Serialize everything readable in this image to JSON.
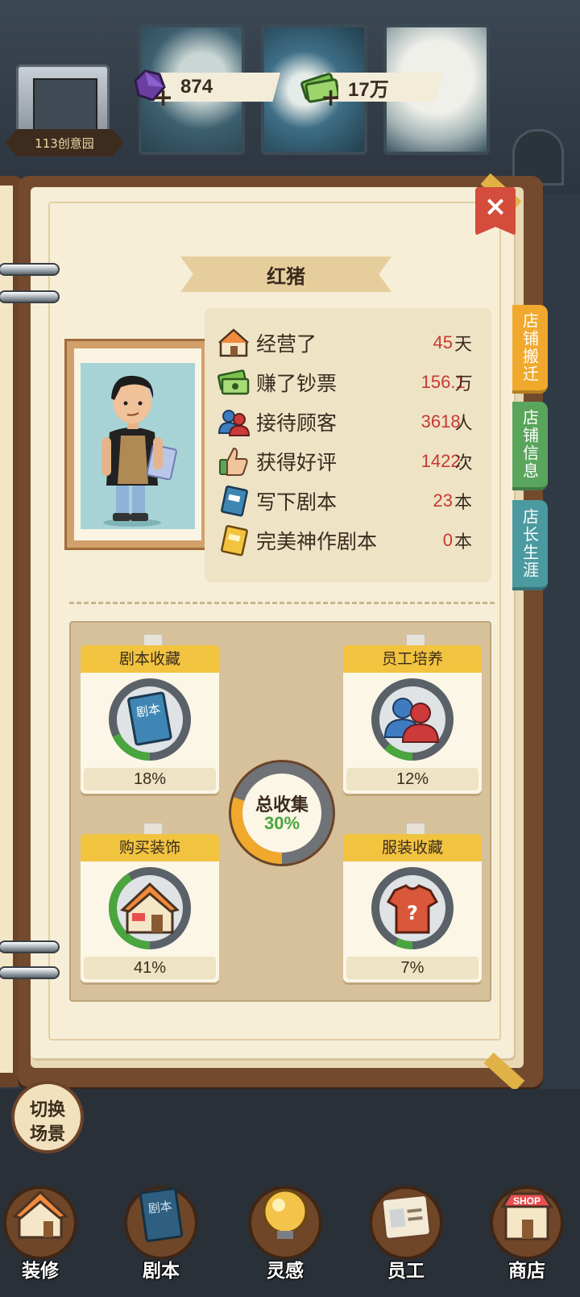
{
  "header": {
    "shop_name": "113创意园",
    "gems": "874",
    "cash": "17万",
    "plus": "+"
  },
  "profile": {
    "name": "红猪",
    "close": "×",
    "stats": [
      {
        "label": "经营了",
        "value": "45",
        "unit": "天",
        "icon": "house-icon"
      },
      {
        "label": "赚了钞票",
        "value": "156.1",
        "unit": "万",
        "icon": "cash-icon"
      },
      {
        "label": "接待顾客",
        "value": "3618",
        "unit": "人",
        "icon": "customers-icon"
      },
      {
        "label": "获得好评",
        "value": "1422",
        "unit": "次",
        "icon": "thumbs-up-icon"
      },
      {
        "label": "写下剧本",
        "value": "23",
        "unit": "本",
        "icon": "script-book-icon"
      },
      {
        "label": "完美神作剧本",
        "value": "0",
        "unit": "本",
        "icon": "gold-script-icon"
      }
    ]
  },
  "side_tabs": [
    {
      "label": "店铺搬迁",
      "color": "#f0a92c"
    },
    {
      "label": "店铺信息",
      "color": "#5aa55c"
    },
    {
      "label": "店长生涯",
      "color": "#4a9aa0"
    }
  ],
  "collections": {
    "script": {
      "title": "剧本收藏",
      "pct": "18%",
      "progress": 0.18,
      "icon_text": "剧本"
    },
    "staff": {
      "title": "员工培养",
      "pct": "12%",
      "progress": 0.12
    },
    "decor": {
      "title": "购买装饰",
      "pct": "41%",
      "progress": 0.41
    },
    "outfit": {
      "title": "服装收藏",
      "pct": "7%",
      "progress": 0.07,
      "icon_text": "?"
    },
    "total": {
      "label": "总收集",
      "value": "30%",
      "progress": 0.3
    }
  },
  "scene_button": {
    "line1": "切换",
    "line2": "场景"
  },
  "bottom_nav": [
    {
      "label": "装修",
      "icon": "house-icon"
    },
    {
      "label": "剧本",
      "icon": "script-book-icon",
      "icon_text": "剧本"
    },
    {
      "label": "灵感",
      "icon": "lightbulb-icon"
    },
    {
      "label": "员工",
      "icon": "id-badge-icon"
    },
    {
      "label": "商店",
      "icon": "shop-icon",
      "icon_text": "SHOP"
    }
  ],
  "colors": {
    "accent_red": "#c63a31",
    "card_header": "#f2c33f",
    "progress_green": "#4aa53e",
    "progress_orange": "#f0a92c"
  }
}
